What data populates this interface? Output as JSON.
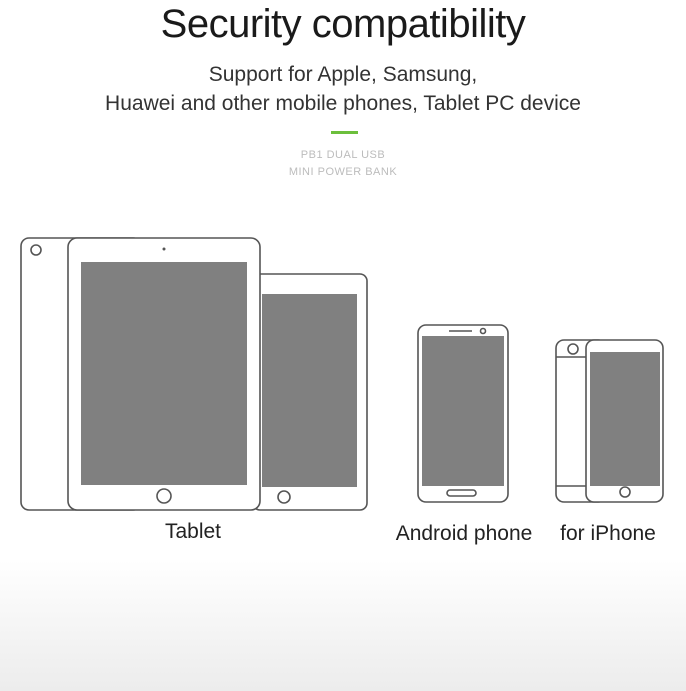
{
  "header": {
    "title": "Security compatibility",
    "subtitle_line1": "Support for Apple, Samsung,",
    "subtitle_line2": "Huawei and other mobile phones, Tablet PC device",
    "product_line1": "PB1 DUAL USB",
    "product_line2": "MINI POWER BANK"
  },
  "devices": [
    {
      "label": "Tablet",
      "icon": "tablet-icon"
    },
    {
      "label": "Android phone",
      "icon": "android-phone-icon"
    },
    {
      "label": "for iPhone",
      "icon": "iphone-icon"
    }
  ],
  "colors": {
    "accent": "#6cbf3c",
    "screen": "#808080",
    "outline": "#555555"
  }
}
